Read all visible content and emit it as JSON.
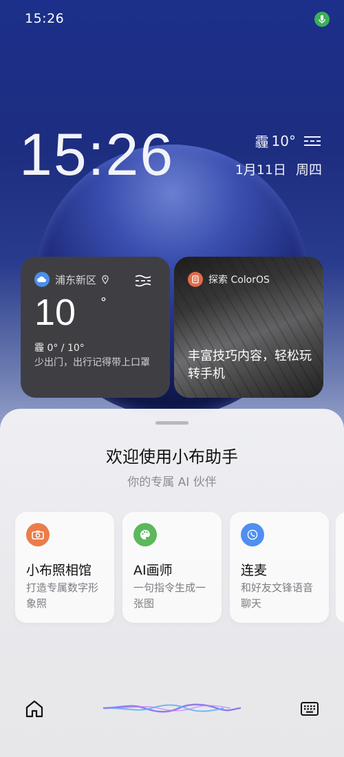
{
  "status_bar": {
    "time": "15:26"
  },
  "lock_screen": {
    "clock": "15:26",
    "weather_condition": "霾",
    "weather_temp": "10°",
    "date": "1月11日",
    "weekday": "周四"
  },
  "weather_widget": {
    "location": "浦东新区",
    "temperature": "10",
    "degree_symbol": "°",
    "condition_range": "霾 0° / 10°",
    "tip": "少出门，出行记得带上口罩"
  },
  "explore_widget": {
    "title": "探索 ColorOS",
    "body": "丰富技巧内容，轻松玩转手机"
  },
  "assistant": {
    "title": "欢迎使用小布助手",
    "subtitle": "你的专属 AI 伙伴",
    "cards": [
      {
        "title": "小布照相馆",
        "desc": "打造专属数字形象照",
        "icon": "camera-icon",
        "color": "#ea7d4a"
      },
      {
        "title": "AI画师",
        "desc": "一句指令生成一张图",
        "icon": "palette-icon",
        "color": "#5cb85c"
      },
      {
        "title": "连麦",
        "desc": "和好友文锋语音聊天",
        "icon": "phone-icon",
        "color": "#4f8ff0"
      }
    ]
  },
  "colors": {
    "mic": "#3bb05a",
    "camera": "#ea7d4a",
    "palette": "#5cb85c",
    "phone": "#4f8ff0"
  }
}
